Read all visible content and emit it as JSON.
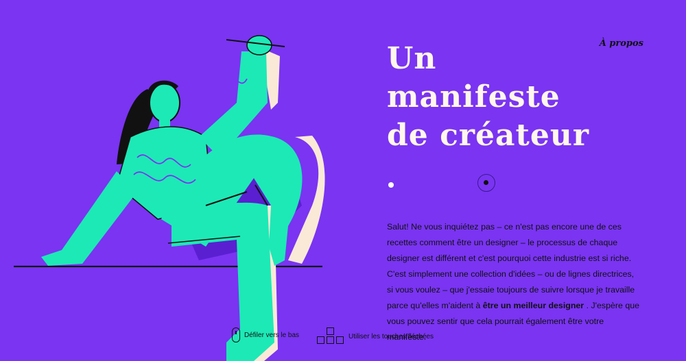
{
  "nav": {
    "about": "À propos"
  },
  "title": {
    "line1": "Un",
    "line2": "manifeste",
    "line3": "de créateur"
  },
  "intro": {
    "part1": "Salut! Ne vous inquiétez pas – ce n'est pas encore une de ces recettes comment être un designer – le processus de chaque designer est différent et c'est pourquoi cette industrie est si riche. C'est simplement une collection d'idées – ou de lignes directrices, si vous voulez – que j'essaie toujours de suivre lorsque je travaille parce qu'elles m'aident à",
    "bold": "être un meilleur designer",
    "part2": ". J'espère que vous pouvez sentir que cela pourrait également être votre manifeste."
  },
  "hints": {
    "scroll": "Défiler vers le bas",
    "keys": "Utiliser les touches fléchées"
  },
  "colors": {
    "background": "#7a34f2",
    "figure": "#1de9b6",
    "shadow": "#fbe9d7",
    "ink": "#111111",
    "title": "#fff7ec"
  }
}
